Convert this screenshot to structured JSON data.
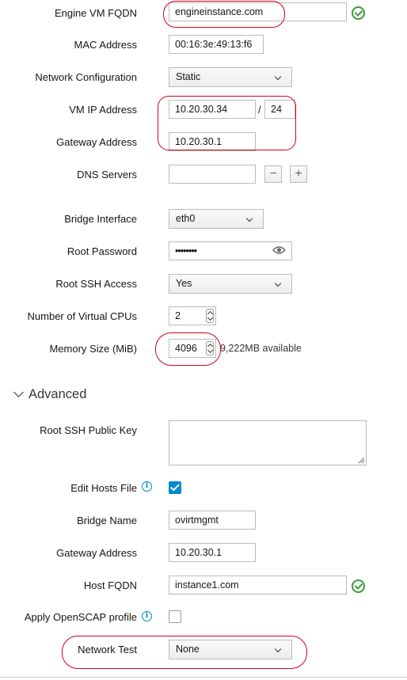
{
  "form": {
    "engine_fqdn": {
      "label": "Engine VM FQDN",
      "value": "engineinstance.com"
    },
    "mac_address": {
      "label": "MAC Address",
      "value": "00:16:3e:49:13:f6"
    },
    "network_configuration": {
      "label": "Network Configuration",
      "value": "Static"
    },
    "vm_ip_address": {
      "label": "VM IP Address",
      "value": "10.20.30.34",
      "separator": "/",
      "prefix": "24"
    },
    "gateway_address": {
      "label": "Gateway Address",
      "value": "10.20.30.1"
    },
    "dns_servers": {
      "label": "DNS Servers",
      "value": "",
      "remove": "−",
      "add": "+"
    },
    "bridge_interface": {
      "label": "Bridge Interface",
      "value": "eth0"
    },
    "root_password": {
      "label": "Root Password",
      "value": "••••••••"
    },
    "root_ssh_access": {
      "label": "Root SSH Access",
      "value": "Yes"
    },
    "num_vcpus": {
      "label": "Number of Virtual CPUs",
      "value": "2"
    },
    "memory_size": {
      "label": "Memory Size (MiB)",
      "value": "4096",
      "available": "9,222MB available"
    }
  },
  "advanced": {
    "title": "Advanced",
    "root_ssh_public_key": {
      "label": "Root SSH Public Key",
      "value": ""
    },
    "edit_hosts_file": {
      "label": "Edit Hosts File",
      "checked": true
    },
    "bridge_name": {
      "label": "Bridge Name",
      "value": "ovirtmgmt"
    },
    "gateway_address": {
      "label": "Gateway Address",
      "value": "10.20.30.1"
    },
    "host_fqdn": {
      "label": "Host FQDN",
      "value": "instance1.com"
    },
    "apply_openscap": {
      "label": "Apply OpenSCAP profile",
      "checked": false
    },
    "network_test": {
      "label": "Network Test",
      "value": "None"
    }
  },
  "colors": {
    "highlight": "#d0021b",
    "valid": "#3f9c35",
    "info": "#0088ce",
    "checkbox": "#0088ce"
  }
}
